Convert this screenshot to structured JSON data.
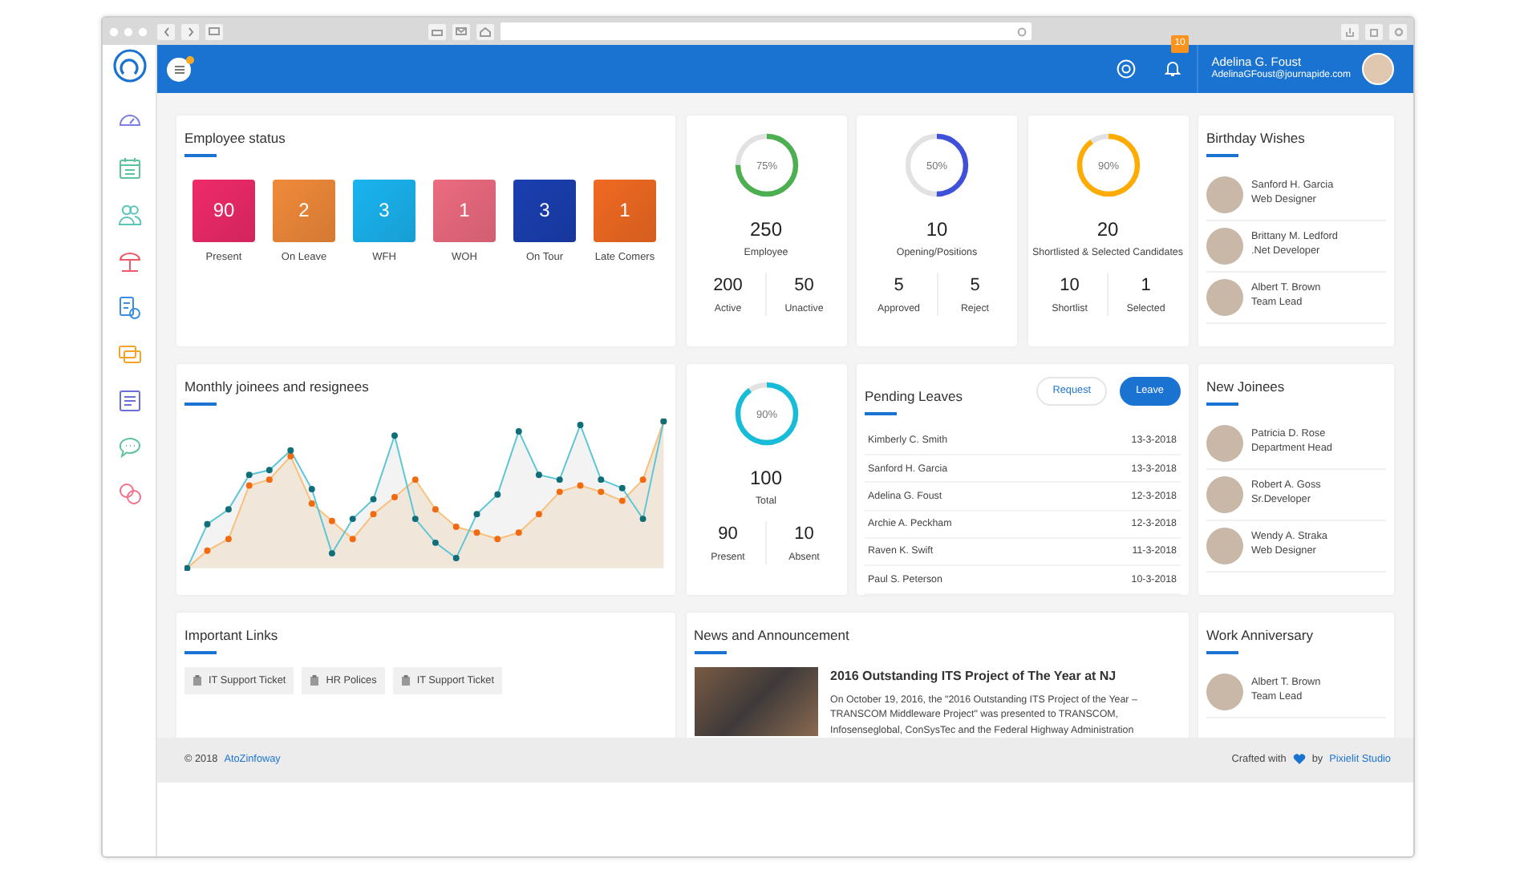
{
  "topbar": {
    "notification_count": "10",
    "user_name": "Adelina G. Foust",
    "user_email": "AdelinaGFoust@journapide.com"
  },
  "employee_status": {
    "title": "Employee status",
    "tiles": [
      {
        "value": "90",
        "label": "Present",
        "color": "#ee2a6a"
      },
      {
        "value": "2",
        "label": "On Leave",
        "color": "#f08a3a"
      },
      {
        "value": "3",
        "label": "WFH",
        "color": "#1ab4f0"
      },
      {
        "value": "1",
        "label": "WOH",
        "color": "#ec6b80"
      },
      {
        "value": "3",
        "label": "On Tour",
        "color": "#1a3fb0"
      },
      {
        "value": "1",
        "label": "Late Comers",
        "color": "#f06a22"
      }
    ]
  },
  "stat_cards": [
    {
      "percent": "75%",
      "level": 0.75,
      "color": "#4caf50",
      "total": "250",
      "label": "Employee",
      "sub": [
        {
          "value": "200",
          "label": "Active"
        },
        {
          "value": "50",
          "label": "Unactive"
        }
      ]
    },
    {
      "percent": "50%",
      "level": 0.5,
      "color": "#3f51d8",
      "total": "10",
      "label": "Opening/Positions",
      "sub": [
        {
          "value": "5",
          "label": "Approved"
        },
        {
          "value": "5",
          "label": "Reject"
        }
      ]
    },
    {
      "percent": "90%",
      "level": 0.9,
      "color": "#ffab00",
      "total": "20",
      "label": "Shortlisted & Selected Candidates",
      "sub": [
        {
          "value": "10",
          "label": "Shortlist"
        },
        {
          "value": "1",
          "label": "Selected"
        }
      ]
    }
  ],
  "birthday_wishes": {
    "title": "Birthday Wishes",
    "people": [
      {
        "name": "Sanford H. Garcia",
        "role": "Web Designer"
      },
      {
        "name": "Brittany M. Ledford",
        "role": ".Net Developer"
      },
      {
        "name": "Albert T. Brown",
        "role": "Team Lead"
      }
    ]
  },
  "monthly_chart": {
    "title": "Monthly joinees and resignees"
  },
  "attendance_card": {
    "percent": "90%",
    "level": 0.9,
    "color": "#17bcd8",
    "total": "100",
    "label": "Total",
    "sub": [
      {
        "value": "90",
        "label": "Present"
      },
      {
        "value": "10",
        "label": "Absent"
      }
    ]
  },
  "pending_leaves": {
    "title": "Pending Leaves",
    "tabs": [
      {
        "label": "Request",
        "selected": false
      },
      {
        "label": "Leave",
        "selected": true
      }
    ],
    "rows": [
      {
        "name": "Kimberly C. Smith",
        "date": "13-3-2018"
      },
      {
        "name": "Sanford H. Garcia",
        "date": "13-3-2018"
      },
      {
        "name": "Adelina G. Foust",
        "date": "12-3-2018"
      },
      {
        "name": "Archie A. Peckham",
        "date": "12-3-2018"
      },
      {
        "name": "Raven K. Swift",
        "date": "11-3-2018"
      },
      {
        "name": "Paul S. Peterson",
        "date": "10-3-2018"
      }
    ]
  },
  "new_joinees": {
    "title": "New Joinees",
    "people": [
      {
        "name": "Patricia D. Rose",
        "role": "Department Head"
      },
      {
        "name": "Robert A. Goss",
        "role": "Sr.Developer"
      },
      {
        "name": "Wendy A. Straka",
        "role": "Web Designer"
      }
    ]
  },
  "important_links": {
    "title": "Important Links",
    "links": [
      "IT Support Ticket",
      "HR Polices",
      "IT Support Ticket"
    ]
  },
  "news": {
    "title": "News and Announcement",
    "headline": "2016 Outstanding ITS Project of The Year at NJ",
    "body": "On October 19, 2016, the \"2016 Outstanding ITS Project of the Year – TRANSCOM Middleware Project\" was presented to TRANSCOM, Infosenseglobal, ConSysTec and the Federal Highway Administration"
  },
  "work_anniversary": {
    "title": "Work Anniversary",
    "people": [
      {
        "name": "Albert T. Brown",
        "role": "Team Lead"
      }
    ]
  },
  "footer": {
    "copyright": "© 2018",
    "company": "AtoZinfoway",
    "crafted": "Crafted with",
    "by": "by",
    "studio": "Pixielit Studio"
  }
}
